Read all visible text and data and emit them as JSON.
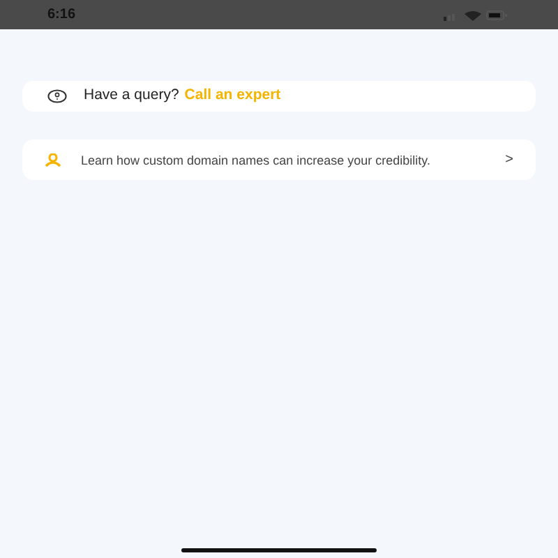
{
  "status_bar": {
    "time": "6:16"
  },
  "query_card": {
    "text": "Have a query?",
    "link": "Call an expert"
  },
  "info_card": {
    "text": "Learn how custom domain names can increase your credibility.",
    "chevron": ">"
  }
}
